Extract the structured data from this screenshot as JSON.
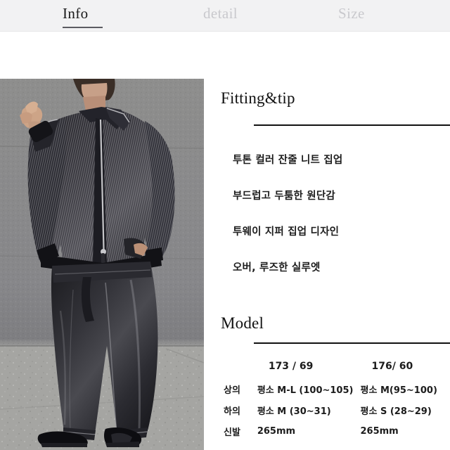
{
  "tabs": [
    {
      "label": "Info",
      "state": "active"
    },
    {
      "label": "detail",
      "state": "inactive"
    },
    {
      "label": "Size",
      "state": "inactive"
    }
  ],
  "photo": {
    "alt": "Model wearing two-tone striped knit zip-up jacket and wide-leg dark jeans against a concrete wall"
  },
  "fitting": {
    "title": "Fitting&tip",
    "bullets": [
      "투톤 컬러 잔줄 니트 집업",
      "부드럽고 두툼한 원단감",
      "투웨이 지퍼 집업 디자인",
      "오버, 루즈한 실루엣"
    ]
  },
  "model": {
    "title": "Model",
    "columns": [
      "",
      "173 / 69",
      "176/ 60"
    ],
    "rows": [
      {
        "label": "상의",
        "a": "평소 M-L (100~105)",
        "b": "평소 M(95~100)"
      },
      {
        "label": "하의",
        "a": "평소 M (30~31)",
        "b": "평소 S (28~29)"
      },
      {
        "label": "신발",
        "a": "265mm",
        "b": "265mm"
      }
    ]
  },
  "colors": {
    "tabbar_bg": "#f2f2f3",
    "active_tab": "#1a1a1a",
    "inactive_tab": "#c9c9cd",
    "rule": "#111111",
    "text": "#1c1c1c"
  }
}
